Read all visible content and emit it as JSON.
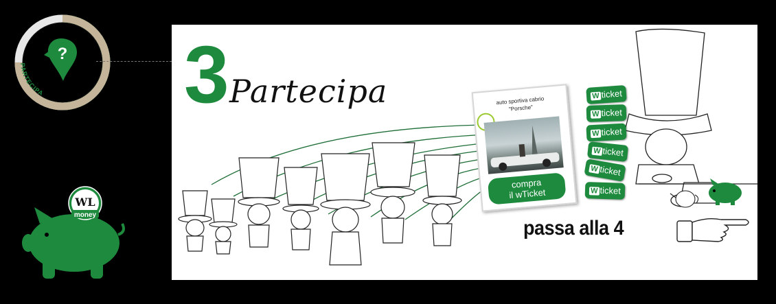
{
  "progress": {
    "label": "PARTECIPA",
    "step": 3,
    "total_steps": 4,
    "fraction": 0.75,
    "colors": {
      "done": "#1e8a3e",
      "current": "#c4b499",
      "remaining": "#e8e8e8"
    }
  },
  "help_icon": {
    "symbol": "?"
  },
  "piggy": {
    "logo_text": "WL",
    "label": "money",
    "color": "#1e8a3e"
  },
  "panel": {
    "step_number": "3",
    "step_title": "Partecipa",
    "card": {
      "title_line1": "auto sportiva cabrio",
      "title_line2": "\"Porsche\"",
      "button_line1": "compra",
      "button_line2": "il wTicket"
    },
    "tickets": [
      {
        "w": "W",
        "text": "ticket"
      },
      {
        "w": "W",
        "text": "ticket"
      },
      {
        "w": "W",
        "text": "ticket"
      },
      {
        "w": "W",
        "text": "ticket"
      },
      {
        "w": "W",
        "text": "ticket"
      },
      {
        "w": "W",
        "text": "ticket"
      }
    ],
    "next_step_label": "passa alla 4"
  },
  "colors": {
    "accent": "#1e8a3e",
    "panel_bg": "#ffffff",
    "page_bg": "#000000"
  }
}
